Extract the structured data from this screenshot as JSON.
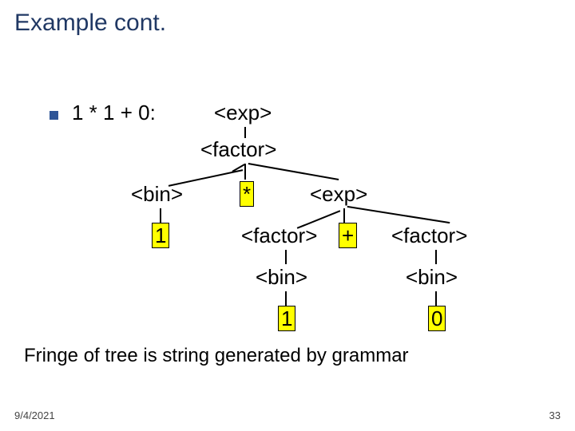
{
  "title": "Example cont.",
  "bullet_expr": "1 * 1 + 0:",
  "nodes": {
    "exp_root": "<exp>",
    "factor_root": "<factor>",
    "bin_L": "<bin>",
    "star": "*",
    "exp_R": "<exp>",
    "one_L": "1",
    "factor_M": "<factor>",
    "plus": "+",
    "factor_R": "<factor>",
    "bin_M": "<bin>",
    "bin_R": "<bin>",
    "one_M": "1",
    "zero_R": "0"
  },
  "caption": "Fringe of tree is string generated by grammar",
  "footer": {
    "date": "9/4/2021",
    "page": "33"
  }
}
